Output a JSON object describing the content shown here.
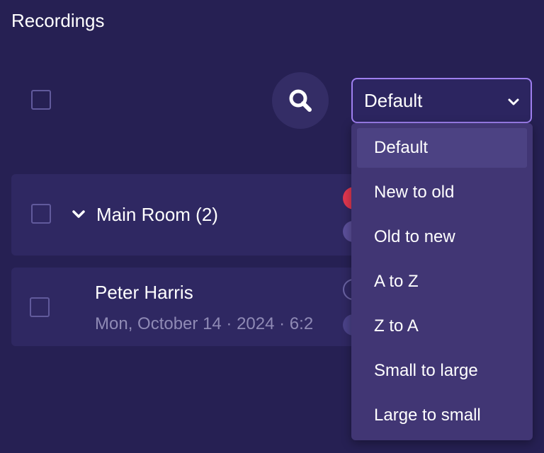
{
  "app": {
    "title": "Recordings"
  },
  "toolbar": {
    "sort_selected": "Default",
    "search_icon": "magnifier-icon",
    "chevron_icon": "chevron-down-icon"
  },
  "sort_menu": {
    "options": [
      "Default",
      "New to old",
      "Old to new",
      "A to Z",
      "Z to A",
      "Small to large",
      "Large to small"
    ],
    "selected_index": 0
  },
  "groups": [
    {
      "label": "Main Room (2)",
      "expanded": true,
      "recordings": [
        {
          "name": "Peter Harris",
          "date": "Mon, October 14 · 2024 · 6:2"
        }
      ]
    }
  ],
  "colors": {
    "background": "#262053",
    "card": "#2f2862",
    "dropdown": "#413674",
    "accent_border": "#9f7ff0",
    "record_red": "#e0374f"
  }
}
